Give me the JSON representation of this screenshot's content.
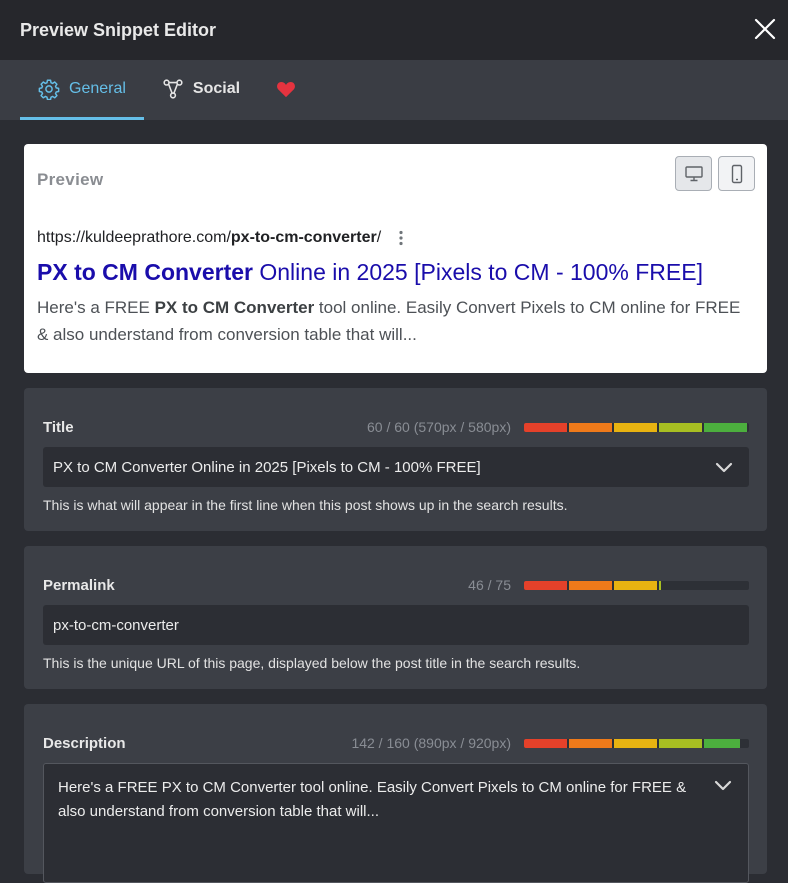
{
  "header": {
    "title": "Preview Snippet Editor"
  },
  "tabs": [
    {
      "label": "General",
      "active": true
    },
    {
      "label": "Social",
      "active": false
    },
    {
      "label": "",
      "icon": "heart-icon",
      "color": "#e5333f"
    }
  ],
  "preview": {
    "label": "Preview",
    "url_prefix": "https://kuldeeprathore.com/",
    "url_slug": "px-to-cm-converter",
    "url_suffix": "/",
    "title_bold": "PX to CM Converter",
    "title_rest": " Online in 2025 [Pixels to CM - 100% FREE]",
    "desc_1": "Here's a FREE ",
    "desc_bold": "PX to CM Converter",
    "desc_2": " tool online. Easily Convert Pixels to CM online for FREE & also understand from conversion table that will..."
  },
  "fields": {
    "title": {
      "label": "Title",
      "count": "60 / 60 (570px / 580px)",
      "value": "PX to CM Converter Online in 2025 [Pixels to CM - 100% FREE]",
      "help": "This is what will appear in the first line when this post shows up in the search results.",
      "fill": 1.0
    },
    "permalink": {
      "label": "Permalink",
      "count": "46 / 75",
      "value": "px-to-cm-converter",
      "help": "This is the unique URL of this page, displayed below the post title in the search results.",
      "fill": 0.61
    },
    "description": {
      "label": "Description",
      "count": "142 / 160 (890px / 920px)",
      "value": "Here's a FREE PX to CM Converter tool online. Easily Convert Pixels to CM online for FREE & also understand from conversion table that will...",
      "fill": 0.96
    }
  },
  "colors": {
    "accent": "#65bfe8",
    "meter": [
      "#e5412a",
      "#ef7a1a",
      "#e8b311",
      "#a8bf22",
      "#4caf3e"
    ],
    "serp_title": "#1a0dab"
  }
}
